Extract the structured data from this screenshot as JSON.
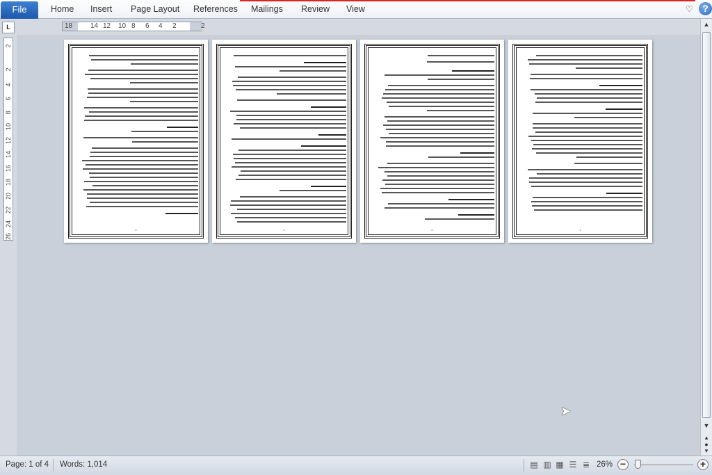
{
  "ribbon": {
    "file": "File",
    "tabs": [
      "Home",
      "Insert",
      "Page Layout",
      "References",
      "Mailings",
      "Review",
      "View"
    ],
    "help": "?"
  },
  "ruler": {
    "horizontal": [
      "18",
      "14",
      "12",
      "10",
      "8",
      "6",
      "4",
      "2",
      "2"
    ],
    "vertical": [
      "2",
      "2",
      "4",
      "6",
      "8",
      "10",
      "12",
      "14",
      "16",
      "18",
      "20",
      "22",
      "24",
      "26"
    ],
    "tab_selector": "L"
  },
  "pages": [
    {
      "number": "4"
    },
    {
      "number": "3"
    },
    {
      "number": "2"
    },
    {
      "number": "1"
    }
  ],
  "status": {
    "page": "Page: 1 of 4",
    "words": "Words: 1,014",
    "zoom": "26%",
    "zoom_percent": 26
  },
  "colors": {
    "file_tab": "#2a66c0",
    "doc_bg": "#c9d0da"
  }
}
